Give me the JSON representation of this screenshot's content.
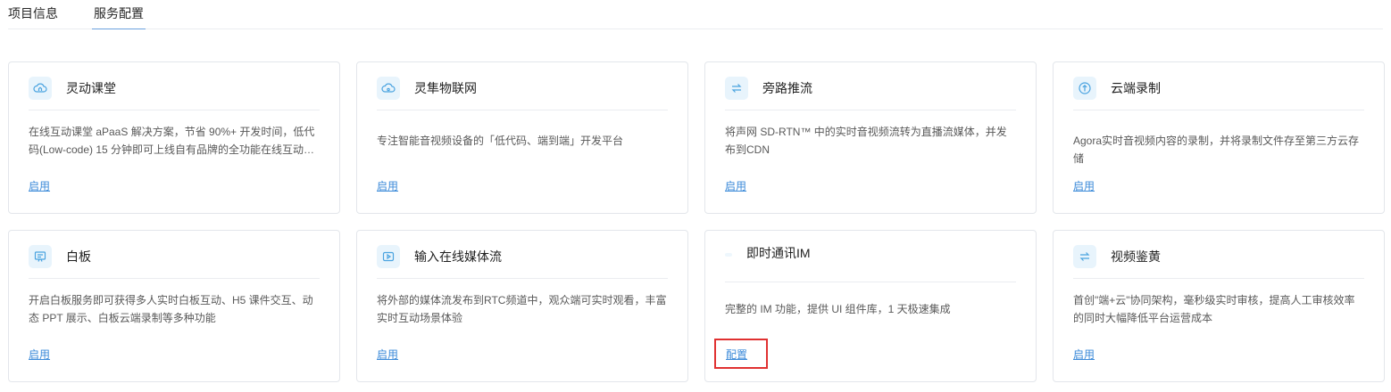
{
  "tabs": [
    {
      "label": "项目信息",
      "active": false
    },
    {
      "label": "服务配置",
      "active": true
    }
  ],
  "cards": [
    {
      "title": "灵动课堂",
      "icon": "cloud-house-icon",
      "desc": "在线互动课堂 aPaaS 解决方案，节省 90%+ 开发时间，低代码(Low-code) 15 分钟即可上线自有品牌的全功能在线互动教学…",
      "link": "启用"
    },
    {
      "title": "灵隼物联网",
      "icon": "cloud-iot-icon",
      "desc": "专注智能音视频设备的「低代码、端到端」开发平台",
      "link": "启用"
    },
    {
      "title": "旁路推流",
      "icon": "arrows-exchange-icon",
      "desc": "将声网 SD-RTN™ 中的实时音视频流转为直播流媒体，并发布到CDN",
      "link": "启用"
    },
    {
      "title": "云端录制",
      "icon": "cloud-upload-icon",
      "desc": "Agora实时音视频内容的录制，并将录制文件存至第三方云存储",
      "link": "启用"
    },
    {
      "title": "白板",
      "icon": "whiteboard-icon",
      "desc": "开启白板服务即可获得多人实时白板互动、H5 课件交互、动态 PPT 展示、白板云端录制等多种功能",
      "link": "启用"
    },
    {
      "title": "输入在线媒体流",
      "icon": "video-play-icon",
      "desc": "将外部的媒体流发布到RTC频道中，观众端可实时观看，丰富实时互动场景体验",
      "link": "启用"
    },
    {
      "title": "即时通讯IM",
      "icon": "chat-icon",
      "desc": "完整的 IM 功能，提供 UI 组件库，1 天极速集成",
      "link": "配置"
    },
    {
      "title": "视频鉴黄",
      "icon": "arrows-exchange-icon",
      "desc": "首创\"端+云\"协同架构，毫秒级实时审核，提高人工审核效率的同时大幅降低平台运营成本",
      "link": "启用"
    }
  ]
}
